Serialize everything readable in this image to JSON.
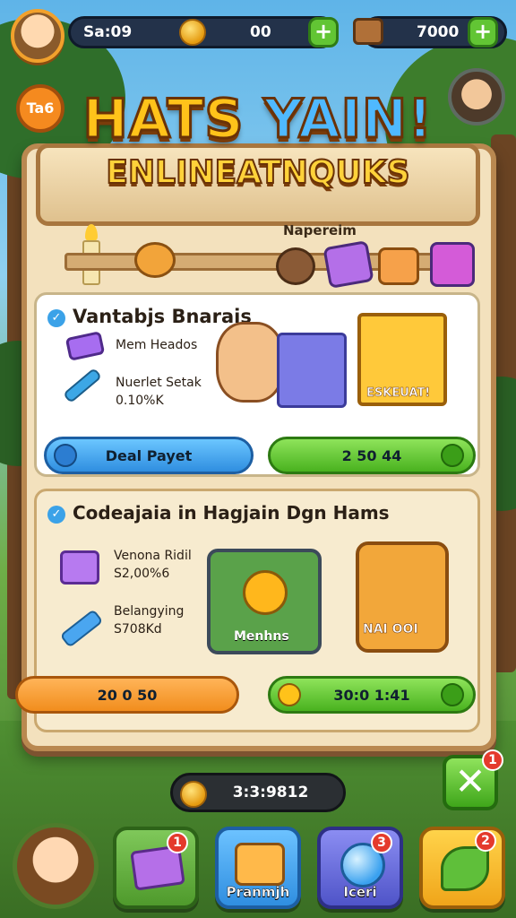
{
  "header": {
    "player_label": "Sa:09",
    "coins_value": "00",
    "gems_value": "7000",
    "plus_symbol": "+"
  },
  "badge_left": {
    "text": "Ta6"
  },
  "title": {
    "part1": "HATS",
    "part2": "YAIN!"
  },
  "subtitle": "ENLINEATNQUKS",
  "shelf_label": "Napereim",
  "panel1": {
    "title": "Vantabjs Bnarais",
    "items": [
      {
        "label": "Mem Heados",
        "icon": "ticket-icon"
      },
      {
        "label": "Nuerlet Setak",
        "sub": "0.10%K",
        "icon": "paintbrush-icon"
      }
    ],
    "chest_label": "ESKEUAT!",
    "btn_left": "Deal Payet",
    "btn_right": "2 50 44"
  },
  "panel2": {
    "title": "Codeajaia in Hagjain Dgn Hams",
    "items": [
      {
        "label": "Venona Ridil",
        "sub": "S2,00%6",
        "icon": "box-icon"
      },
      {
        "label": "Belangying",
        "sub": "S708Kd",
        "icon": "rocket-icon"
      }
    ],
    "card_label": "Menhns",
    "chest_label": "NAI OOI",
    "btn_left": "20 0 50",
    "btn_right": "30:0 1:41"
  },
  "footer": {
    "gold_value": "3:3:9812",
    "close_symbol": "✕",
    "close_badge": "1",
    "nav": [
      {
        "label": "",
        "badge": "1",
        "icon": "mail-icon"
      },
      {
        "label": "Pranmjh",
        "badge": "",
        "icon": "map-scroll-icon"
      },
      {
        "label": "Iceri",
        "badge": "3",
        "icon": "crystal-orb-icon"
      },
      {
        "label": "",
        "badge": "2",
        "icon": "leaf-icon"
      }
    ]
  },
  "colors": {
    "wood": "#b98850",
    "title_gold": "#ffc31a",
    "title_blue": "#4fb9ff",
    "button_green": "#49b21f",
    "button_blue": "#2f8ee0",
    "button_orange": "#f18d1d"
  }
}
